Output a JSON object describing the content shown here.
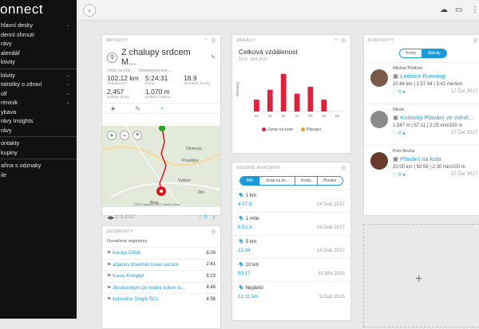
{
  "app": {
    "logo": "onnect"
  },
  "sidebar": {
    "group1": [
      {
        "label": "hlavní desky",
        "chev": true
      },
      {
        "label": "denní shrnutí",
        "chev": false
      },
      {
        "label": "rávy",
        "chev": false
      },
      {
        "label": "alendář",
        "chev": false
      },
      {
        "label": "ktivity",
        "chev": false
      }
    ],
    "group2": [
      {
        "label": "ktivity",
        "chev": true
      },
      {
        "label": "tatistiky o zdraví",
        "chev": true
      },
      {
        "label": "olf",
        "chev": true
      },
      {
        "label": "réninik",
        "chev": true
      },
      {
        "label": "ybava",
        "chev": false
      },
      {
        "label": "rávy Insights",
        "chev": false
      },
      {
        "label": "rávy",
        "chev": false
      }
    ],
    "group3": [
      {
        "label": "ontakty",
        "chev": false
      },
      {
        "label": "kupiny",
        "chev": false
      }
    ],
    "group4": [
      {
        "label": "ařina s odznaky",
        "chev": false
      },
      {
        "label": "ile",
        "chev": false
      }
    ]
  },
  "activity_card": {
    "header": "AKTIVITY",
    "title": "Z chalupy srdcem M...",
    "subtitle_left": "Jízda na kole",
    "subtitle_right": "Nekategorizovat...",
    "stats": [
      {
        "value": "102.12 km",
        "label": "Vzdálenost"
      },
      {
        "value": "5:24:31",
        "label": "Doba"
      },
      {
        "value": "18.9",
        "label": "Rychlost (km/h)"
      },
      {
        "value": "2,457",
        "label": "Kalorie (kcal)"
      },
      {
        "value": "1,070 m",
        "label": "Získaní nadmo..."
      }
    ],
    "zoom_in": "+",
    "zoom_out": "−",
    "date": "11.6.2017",
    "likes": "0",
    "map_labels": [
      "Olomouc",
      "Vyškov",
      "Brno",
      "Zlín",
      "Prostějov"
    ],
    "map_copy": "©2017 Mapbox ©2017 Garmin Terms"
  },
  "segments_card": {
    "header": "SEGMENTY",
    "subheader": "Označené segmenty",
    "rows": [
      {
        "name": "Kanice Climb",
        "time": "6:09"
      },
      {
        "name": "adamov downhill/ lower section",
        "time": "2:41"
      },
      {
        "name": "Karas Komplet",
        "time": "5:23"
      },
      {
        "name": "Josefovským po modré kolem st...",
        "time": "4:46"
      },
      {
        "name": "krdovnice Single SC1",
        "time": "4:58"
      }
    ]
  },
  "reports_card": {
    "header": "ZPRÁVY",
    "title": "Celková vzdálenost",
    "range": "12.6 - 18.6.2017",
    "ylabel": "Kilometry",
    "legend": [
      {
        "name": "Jízda na kole",
        "color": "#e0213b"
      },
      {
        "name": "Plavání",
        "color": "#f2a01e"
      }
    ]
  },
  "chart_data": {
    "type": "bar",
    "categories": [
      "Po",
      "Út",
      "St",
      "Čt",
      "Pá",
      "So",
      "Ne"
    ],
    "series": [
      {
        "name": "Jízda na kole",
        "values": [
          12,
          22,
          38,
          18,
          25,
          12,
          0
        ]
      },
      {
        "name": "Plavání",
        "values": [
          0,
          0,
          0,
          0,
          0,
          0,
          0
        ]
      }
    ],
    "ylabel": "Kilometry",
    "ylim": [
      0,
      45
    ]
  },
  "records_card": {
    "header": "OSOBNÍ REKORDY",
    "tabs": [
      "Běh",
      "Jízda na ko...",
      "Kroky",
      "Plování"
    ],
    "active_tab": 0,
    "rows": [
      {
        "name": "1 km",
        "value": "4:07.8",
        "date": "14 Dub 2017"
      },
      {
        "name": "1 míle",
        "value": "6:52.3",
        "date": "14 Dub 2017"
      },
      {
        "name": "5 km",
        "value": "23:34",
        "date": "14 Dub 2017"
      },
      {
        "name": "10 km",
        "value": "59:17",
        "date": "31 Bře 2015"
      },
      {
        "name": "Nejdelší",
        "value": "12.31 km",
        "date": "5 Dub 2015"
      }
    ]
  },
  "contacts_card": {
    "header": "KONTAKTY",
    "tabs": [
      "Kroky",
      "Aktivity"
    ],
    "active_tab": 1,
    "contacts": [
      {
        "name": "Michal Politzer",
        "activity": "Lednice Running",
        "stats": "20.64 km | 1:57:44 | 5:42 min/km",
        "likes": "0",
        "date": "17 Čer 2017"
      },
      {
        "name": "Mirek",
        "activity": "Knínicky Plavání ve volné...",
        "stats": "1,547 m | 57:11 | 2:25 min/100 m",
        "likes": "0",
        "date": "17 Čer 2017"
      },
      {
        "name": "Petr Broža",
        "activity": "Plavání na kola",
        "stats": "20.00 km | 50:58 | 2:30 min/100 m",
        "likes": "0",
        "date": "17 Čer 2017"
      }
    ]
  },
  "add_widget": {
    "label": "+"
  }
}
